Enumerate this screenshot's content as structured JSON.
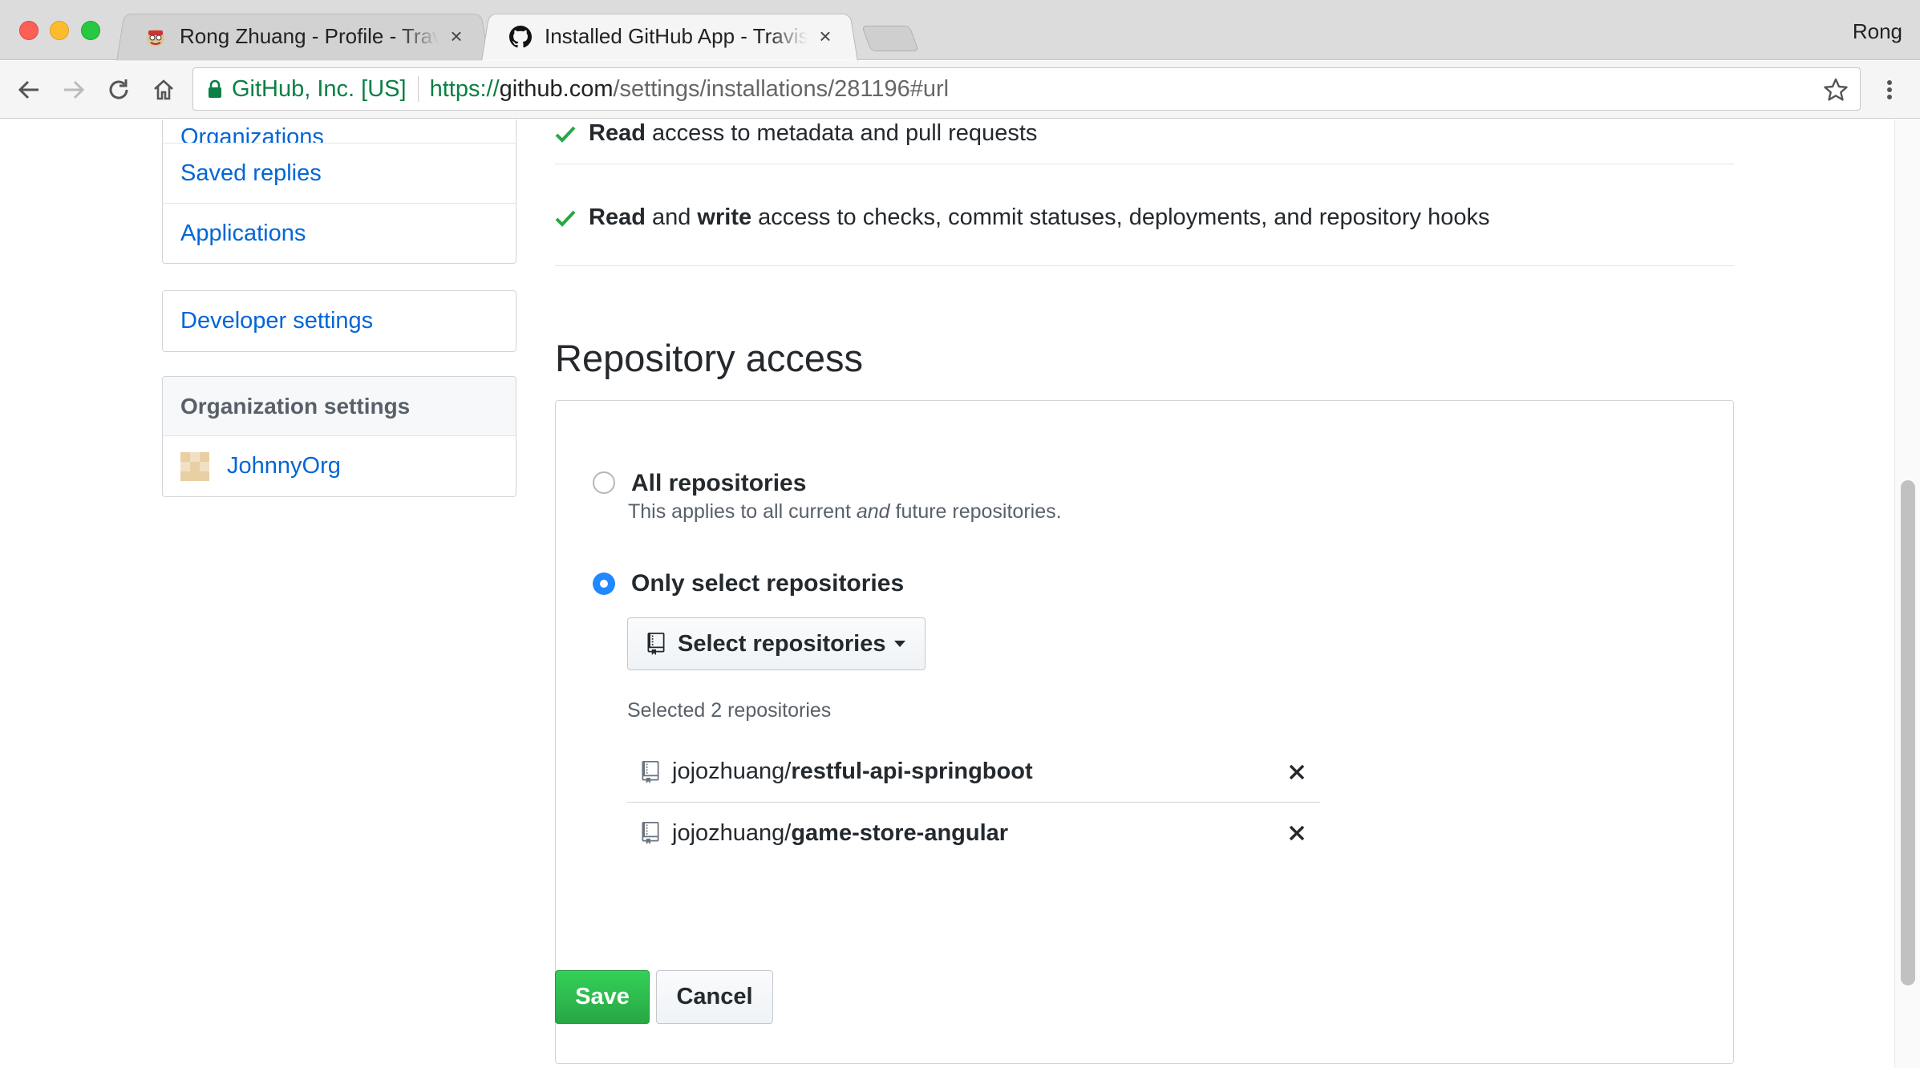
{
  "browser": {
    "tabs": [
      {
        "title": "Rong Zhuang - Profile - Travis CI",
        "favicon": "travis-mascot-icon",
        "active": false
      },
      {
        "title": "Installed GitHub App - Travis CI",
        "favicon": "github-octocat-icon",
        "active": true
      }
    ],
    "profile_name": "Rong",
    "address": {
      "site_identity": "GitHub, Inc. [US]",
      "scheme": "https://",
      "host": "github.com",
      "path": "/settings/installations/281196#url"
    }
  },
  "sidebar": {
    "account_items": [
      "Organizations",
      "Saved replies",
      "Applications"
    ],
    "developer_settings": "Developer settings",
    "org_heading": "Organization settings",
    "org_items": [
      {
        "label": "JohnnyOrg"
      }
    ]
  },
  "permissions": [
    {
      "strong1": "Read",
      "mid": "",
      "strong2": "",
      "rest": " access to metadata and pull requests"
    },
    {
      "strong1": "Read",
      "mid": " and ",
      "strong2": "write",
      "rest": " access to checks, commit statuses, deployments, and repository hooks"
    }
  ],
  "repo_access": {
    "title": "Repository access",
    "all_label": "All repositories",
    "all_note_pre": "This applies to all current ",
    "all_note_em": "and",
    "all_note_post": " future repositories.",
    "select_label": "Only select repositories",
    "selected_option": "only-select",
    "select_button": "Select repositories",
    "selected_count_text": "Selected 2 repositories",
    "repos": [
      {
        "owner": "jojozhuang/",
        "name": "restful-api-springboot"
      },
      {
        "owner": "jojozhuang/",
        "name": "game-store-angular"
      }
    ]
  },
  "actions": {
    "save": "Save",
    "cancel": "Cancel"
  },
  "colors": {
    "link": "#0366d6",
    "save_green": "#28a745",
    "radio_blue": "#2188ff",
    "check_green": "#28a745"
  }
}
